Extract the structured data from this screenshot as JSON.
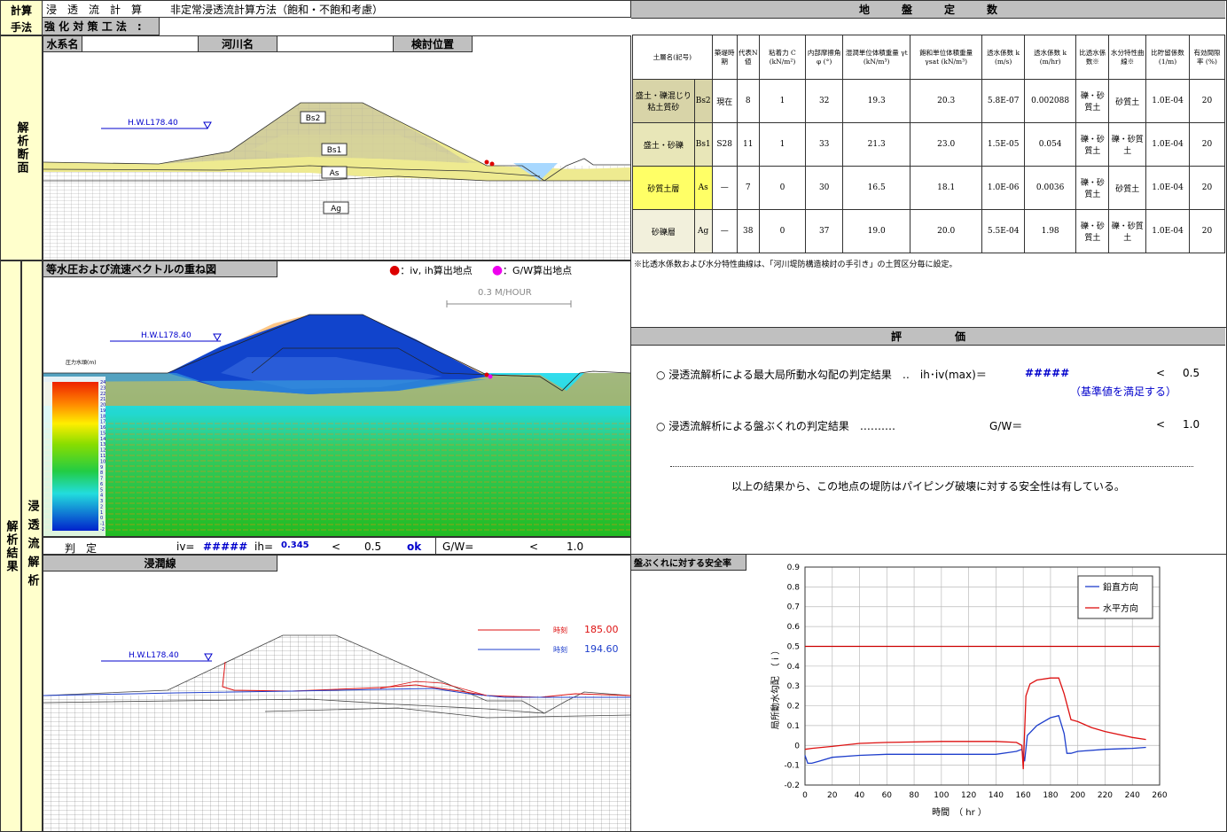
{
  "header": {
    "calc_label": "計算",
    "method_label": "手法",
    "title_label": "浸　透　流　計　算",
    "method_text": "非定常浸透流計算方法（飽和・不飽和考慮）",
    "strengthen_label": "強 化 対 策 工 法　:"
  },
  "section1": {
    "side_label": "解析断面",
    "water_system_label": "水系名",
    "river_label": "河川名",
    "position_label": "検討位置",
    "hwl": "H.W.L178.40",
    "layers": [
      "Bs2",
      "Bs1",
      "As",
      "Ag"
    ]
  },
  "results_side": "解析結果",
  "seepage_side": "浸透流解析",
  "section2": {
    "title": "等水圧および流速ベクトルの重ね図",
    "legend1": "：iv, ih算出地点",
    "legend2": "：G/W算出地点",
    "velocity_scale": "0.3  M/HOUR",
    "hwl": "H.W.L178.40",
    "pressure_label": "圧力水頭(m)",
    "scale_values": [
      "24",
      "23",
      "22",
      "21",
      "20",
      "19",
      "18",
      "17",
      "16",
      "15",
      "14",
      "13",
      "12",
      "11",
      "10",
      "9",
      "8",
      "7",
      "6",
      "5",
      "4",
      "3",
      "2",
      "1",
      "0",
      "-1",
      "-2"
    ],
    "colors": {
      "low": "#0033cc",
      "mid": "#33cc33",
      "high": "#ee2200"
    }
  },
  "judgement": {
    "label": "判　定",
    "iv_label": "iv=",
    "iv_value": "#####",
    "ih_label": "ih=",
    "ih_value": "0.345",
    "lt1": "<",
    "limit1": "0.5",
    "ok": "ok",
    "gw_label": "G/W=",
    "lt2": "<",
    "limit2": "1.0"
  },
  "section3": {
    "title": "浸潤線",
    "hwl": "H.W.L178.40",
    "legend_a_label": "時刻",
    "legend_a_value": "185.00",
    "legend_b_label": "時刻",
    "legend_b_value": "194.60"
  },
  "soil_table": {
    "title": "地　　　盤　　　定　　　数",
    "headers": [
      "土層名(記号)",
      "築堤時期",
      "代表N値",
      "粘着力 C (kN/m²)",
      "内部摩擦角 φ (°)",
      "湿潤単位体積重量 γt (kN/m³)",
      "飽和単位体積重量 γsat (kN/m³)",
      "透水係数 k (m/s)",
      "透水係数 k (m/hr)",
      "比透水係数※",
      "水分特性曲線※",
      "比貯留係数 (1/m)",
      "有効間隙率 (%)"
    ],
    "rows": [
      {
        "name": "盛土・礫混じり粘土質砂",
        "symbol": "Bs2",
        "period": "現在",
        "n": "8",
        "c": "1",
        "phi": "32",
        "gt": "19.3",
        "gsat": "20.3",
        "k1": "5.8E-07",
        "k2": "0.002088",
        "rel": "礫・砂質土",
        "curve": "砂質土",
        "ss": "1.0E-04",
        "por": "20",
        "color": "#d8d4a8"
      },
      {
        "name": "盛土・砂礫",
        "symbol": "Bs1",
        "period": "S28",
        "n": "11",
        "c": "1",
        "phi": "33",
        "gt": "21.3",
        "gsat": "23.0",
        "k1": "1.5E-05",
        "k2": "0.054",
        "rel": "礫・砂質土",
        "curve": "礫・砂質土",
        "ss": "1.0E-04",
        "por": "20",
        "color": "#e8e6b8"
      },
      {
        "name": "砂質土層",
        "symbol": "As",
        "period": "—",
        "n": "7",
        "c": "0",
        "phi": "30",
        "gt": "16.5",
        "gsat": "18.1",
        "k1": "1.0E-06",
        "k2": "0.0036",
        "rel": "礫・砂質土",
        "curve": "砂質土",
        "ss": "1.0E-04",
        "por": "20",
        "color": "#ffff66"
      },
      {
        "name": "砂礫層",
        "symbol": "Ag",
        "period": "—",
        "n": "38",
        "c": "0",
        "phi": "37",
        "gt": "19.0",
        "gsat": "20.0",
        "k1": "5.5E-04",
        "k2": "1.98",
        "rel": "礫・砂質土",
        "curve": "礫・砂質土",
        "ss": "1.0E-04",
        "por": "20",
        "color": "#f2f0dc"
      }
    ],
    "note": "※比透水係数および水分特性曲線は、「河川堤防構造検討の手引き」の土質区分毎に設定。"
  },
  "evaluation": {
    "title": "評　　　　　価",
    "line1_text": "○ 浸透流解析による最大局所動水勾配の判定結果　‥　ih･iv(max)＝",
    "line1_value": "#####",
    "line1_lt": "<",
    "line1_limit": "0.5",
    "line1_note": "（基準値を満足する）",
    "line2_text": "○ 浸透流解析による盤ぶくれの判定結果　‥‥‥‥‥",
    "line2_gw": "G/W＝",
    "line2_lt": "<",
    "line2_limit": "1.0",
    "conclusion": "以上の結果から、この地点の堤防はパイピング破壊に対する安全性は有している。"
  },
  "chart_panel": {
    "title": "盤ぶくれに対する安全率"
  },
  "chart_data": {
    "type": "line",
    "title": "",
    "xlabel": "時間　（ hr ）",
    "ylabel": "局所動水勾配　（ i ）",
    "xlim": [
      0,
      260
    ],
    "ylim": [
      -0.2,
      0.9
    ],
    "xticks": [
      0,
      20,
      40,
      60,
      80,
      100,
      120,
      140,
      160,
      180,
      200,
      220,
      240,
      260
    ],
    "yticks": [
      -0.2,
      -0.1,
      0,
      0.1,
      0.2,
      0.3,
      0.4,
      0.5,
      0.6,
      0.7,
      0.8,
      0.9
    ],
    "grid": true,
    "legend_position": "top-right",
    "series": [
      {
        "name": "鉛直方向",
        "color": "#1f3fcc",
        "x": [
          0,
          2,
          5,
          10,
          20,
          40,
          60,
          100,
          140,
          155,
          159,
          161,
          163,
          170,
          180,
          186,
          190,
          192,
          195,
          200,
          220,
          240,
          250
        ],
        "y": [
          -0.05,
          -0.09,
          -0.09,
          -0.08,
          -0.06,
          -0.05,
          -0.045,
          -0.045,
          -0.045,
          -0.03,
          -0.02,
          -0.08,
          0.05,
          0.1,
          0.14,
          0.15,
          0.06,
          -0.04,
          -0.04,
          -0.03,
          -0.02,
          -0.015,
          -0.01
        ]
      },
      {
        "name": "水平方向",
        "color": "#dd1111",
        "x": [
          0,
          5,
          20,
          40,
          60,
          100,
          140,
          155,
          159,
          160,
          162,
          165,
          170,
          180,
          186,
          190,
          195,
          200,
          210,
          220,
          240,
          250
        ],
        "y": [
          -0.02,
          -0.015,
          -0.005,
          0.01,
          0.015,
          0.02,
          0.02,
          0.015,
          0.0,
          -0.12,
          0.25,
          0.31,
          0.33,
          0.34,
          0.34,
          0.26,
          0.13,
          0.12,
          0.09,
          0.07,
          0.04,
          0.03
        ]
      },
      {
        "name": "",
        "color": "#cc0000",
        "x": [
          0,
          260
        ],
        "y": [
          0.5,
          0.5
        ]
      }
    ]
  }
}
